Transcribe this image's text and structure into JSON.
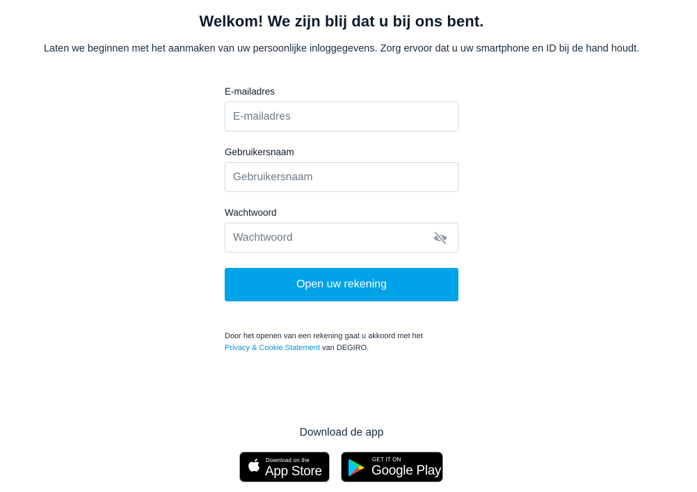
{
  "header": {
    "title": "Welkom! We zijn blij dat u bij ons bent.",
    "subtitle": "Laten we beginnen met het aanmaken van uw persoonlijke inloggegevens. Zorg ervoor dat u uw smartphone en ID bij de hand houdt."
  },
  "form": {
    "email": {
      "label": "E-mailadres",
      "placeholder": "E-mailadres",
      "value": ""
    },
    "username": {
      "label": "Gebruikersnaam",
      "placeholder": "Gebruikersnaam",
      "value": ""
    },
    "password": {
      "label": "Wachtwoord",
      "placeholder": "Wachtwoord",
      "value": "",
      "toggle_icon": "eye-slash-icon"
    },
    "submit_label": "Open uw rekening",
    "terms": {
      "prefix": "Door het openen van een rekening gaat u akkoord met het",
      "link": "Privacy & Cookie Statement",
      "suffix": " van DEGIRO."
    }
  },
  "download": {
    "title": "Download de app",
    "app_store": {
      "small": "Download on the",
      "big": "App Store",
      "icon": "apple-icon"
    },
    "google_play": {
      "small": "GET IT ON",
      "big": "Google Play",
      "icon": "google-play-icon"
    }
  },
  "colors": {
    "accent": "#00a2e8",
    "link": "#0a8fd1",
    "text": "#0b1b2b",
    "input_border": "#d3d8de",
    "placeholder": "#6f7a85",
    "badge_bg": "#000000"
  }
}
